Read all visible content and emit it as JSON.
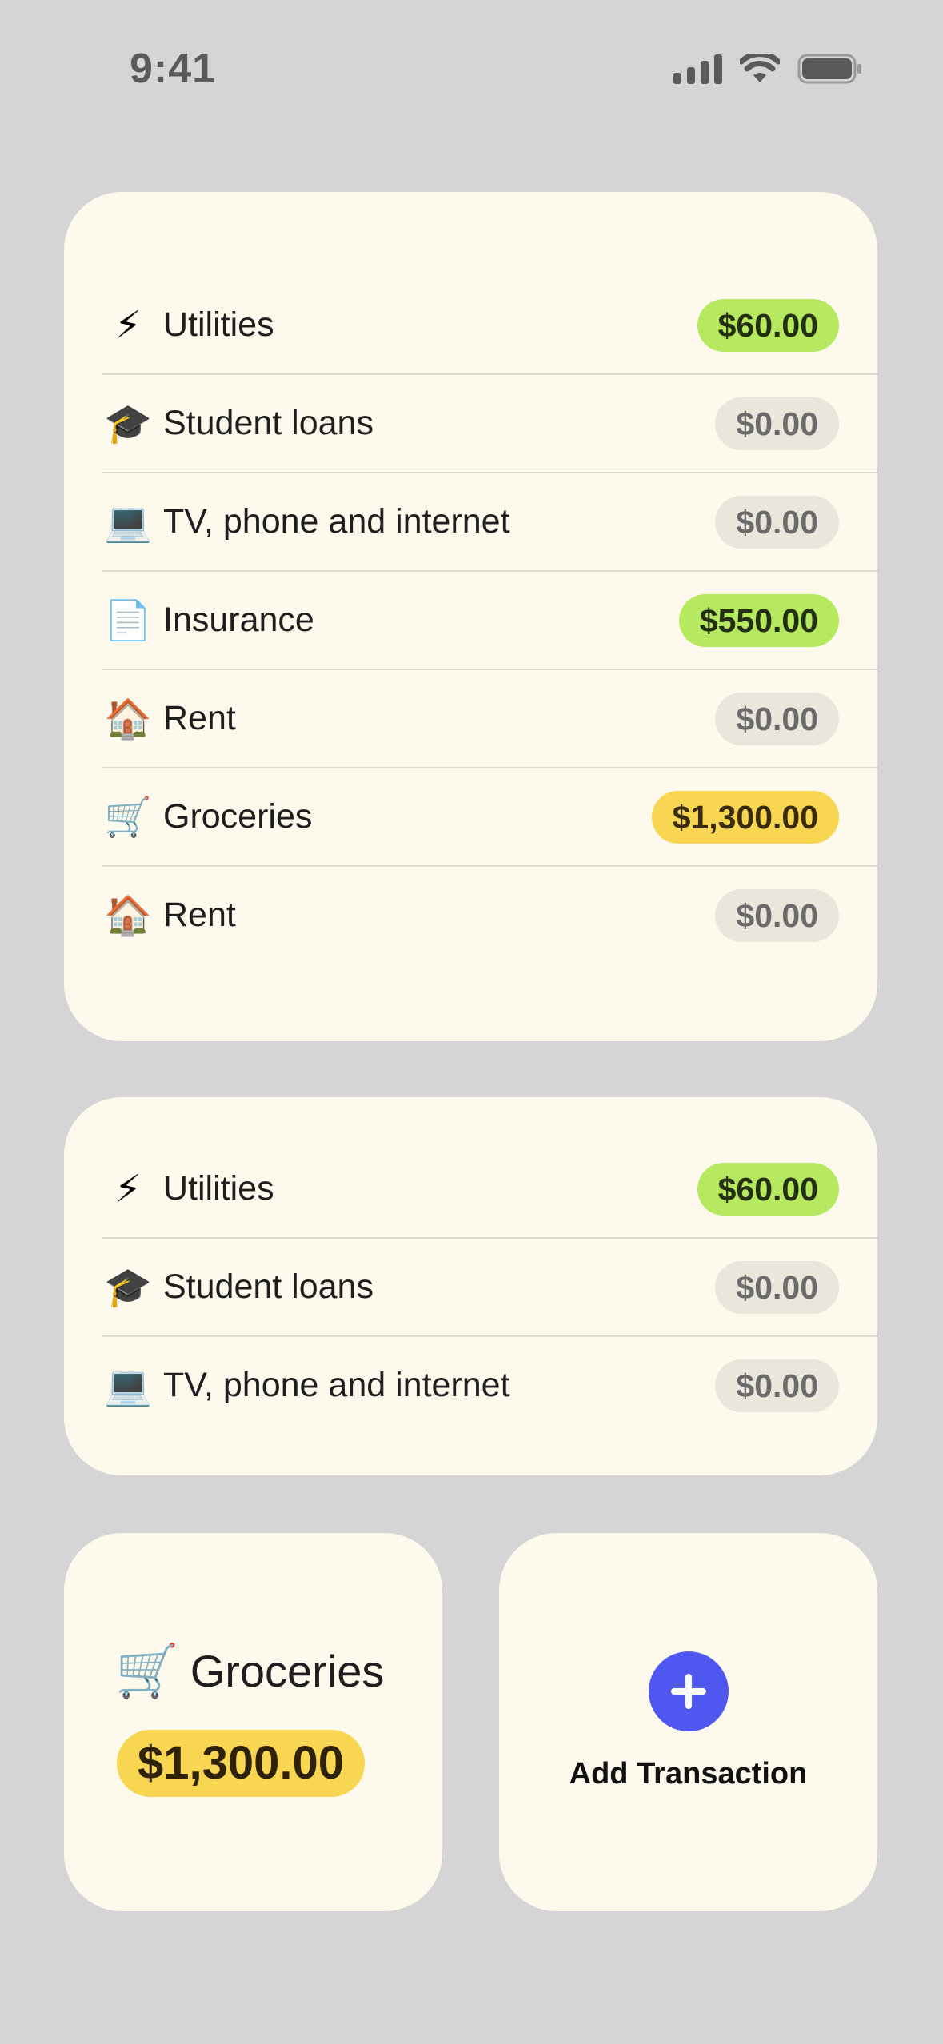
{
  "status_bar": {
    "time": "9:41"
  },
  "big_card": {
    "items": [
      {
        "icon": "⚡",
        "icon_name": "lightning-icon",
        "label": "Utilities",
        "amount": "$60.00",
        "tone": "green"
      },
      {
        "icon": "🎓",
        "icon_name": "graduation-cap-icon",
        "label": "Student loans",
        "amount": "$0.00",
        "tone": "grey"
      },
      {
        "icon": "💻",
        "icon_name": "laptop-icon",
        "label": "TV, phone and internet",
        "amount": "$0.00",
        "tone": "grey"
      },
      {
        "icon": "📄",
        "icon_name": "document-icon",
        "label": "Insurance",
        "amount": "$550.00",
        "tone": "green"
      },
      {
        "icon": "🏠",
        "icon_name": "house-icon",
        "label": "Rent",
        "amount": "$0.00",
        "tone": "grey"
      },
      {
        "icon": "🛒",
        "icon_name": "shopping-cart-icon",
        "label": "Groceries",
        "amount": "$1,300.00",
        "tone": "yellow"
      },
      {
        "icon": "🏠",
        "icon_name": "house-icon",
        "label": "Rent",
        "amount": "$0.00",
        "tone": "grey"
      }
    ]
  },
  "medium_card": {
    "items": [
      {
        "icon": "⚡",
        "icon_name": "lightning-icon",
        "label": "Utilities",
        "amount": "$60.00",
        "tone": "green"
      },
      {
        "icon": "🎓",
        "icon_name": "graduation-cap-icon",
        "label": "Student loans",
        "amount": "$0.00",
        "tone": "grey"
      },
      {
        "icon": "💻",
        "icon_name": "laptop-icon",
        "label": "TV, phone and internet",
        "amount": "$0.00",
        "tone": "grey"
      }
    ]
  },
  "groceries_widget": {
    "icon": "🛒",
    "label": "Groceries",
    "amount": "$1,300.00"
  },
  "add_widget": {
    "label": "Add Transaction"
  },
  "colors": {
    "background": "#d5d5d5",
    "card": "#fdf9ec",
    "green_pill": "#b6e960",
    "grey_pill": "#ebe6db",
    "yellow_pill": "#f8d651",
    "accent_blue": "#4f57f0"
  }
}
